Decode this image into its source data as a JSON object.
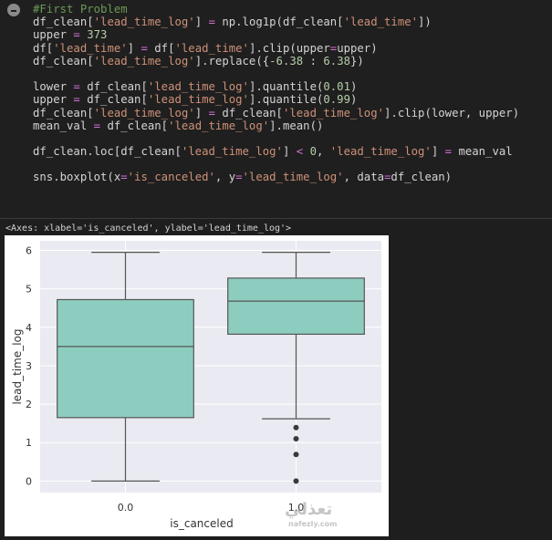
{
  "cell": {
    "lines": [
      [
        {
          "t": "#First Problem",
          "c": "cmt"
        }
      ],
      [
        {
          "t": "df_clean[",
          "c": "kw"
        },
        {
          "t": "'lead_time_log'",
          "c": "str"
        },
        {
          "t": "] ",
          "c": "kw"
        },
        {
          "t": "=",
          "c": "op"
        },
        {
          "t": " np.log1p(df_clean[",
          "c": "kw"
        },
        {
          "t": "'lead_time'",
          "c": "str"
        },
        {
          "t": "])",
          "c": "kw"
        }
      ],
      [
        {
          "t": "upper ",
          "c": "kw"
        },
        {
          "t": "=",
          "c": "op"
        },
        {
          "t": " ",
          "c": "kw"
        },
        {
          "t": "373",
          "c": "num"
        }
      ],
      [
        {
          "t": "df[",
          "c": "kw"
        },
        {
          "t": "'lead_time'",
          "c": "str"
        },
        {
          "t": "] ",
          "c": "kw"
        },
        {
          "t": "=",
          "c": "op"
        },
        {
          "t": " df[",
          "c": "kw"
        },
        {
          "t": "'lead_time'",
          "c": "str"
        },
        {
          "t": "].clip(upper",
          "c": "kw"
        },
        {
          "t": "=",
          "c": "op"
        },
        {
          "t": "upper)",
          "c": "kw"
        }
      ],
      [
        {
          "t": "df_clean[",
          "c": "kw"
        },
        {
          "t": "'lead_time_log'",
          "c": "str"
        },
        {
          "t": "].replace({",
          "c": "kw"
        },
        {
          "t": "-6.38",
          "c": "num"
        },
        {
          "t": " : ",
          "c": "kw"
        },
        {
          "t": "6.38",
          "c": "num"
        },
        {
          "t": "})",
          "c": "kw"
        }
      ],
      [
        {
          "t": "",
          "c": "kw"
        }
      ],
      [
        {
          "t": "lower ",
          "c": "kw"
        },
        {
          "t": "=",
          "c": "op"
        },
        {
          "t": " df_clean[",
          "c": "kw"
        },
        {
          "t": "'lead_time_log'",
          "c": "str"
        },
        {
          "t": "].quantile(",
          "c": "kw"
        },
        {
          "t": "0.01",
          "c": "num"
        },
        {
          "t": ")",
          "c": "kw"
        }
      ],
      [
        {
          "t": "upper ",
          "c": "kw"
        },
        {
          "t": "=",
          "c": "op"
        },
        {
          "t": " df_clean[",
          "c": "kw"
        },
        {
          "t": "'lead_time_log'",
          "c": "str"
        },
        {
          "t": "].quantile(",
          "c": "kw"
        },
        {
          "t": "0.99",
          "c": "num"
        },
        {
          "t": ")",
          "c": "kw"
        }
      ],
      [
        {
          "t": "df_clean[",
          "c": "kw"
        },
        {
          "t": "'lead_time_log'",
          "c": "str"
        },
        {
          "t": "] ",
          "c": "kw"
        },
        {
          "t": "=",
          "c": "op"
        },
        {
          "t": " df_clean[",
          "c": "kw"
        },
        {
          "t": "'lead_time_log'",
          "c": "str"
        },
        {
          "t": "].clip(lower, upper)",
          "c": "kw"
        }
      ],
      [
        {
          "t": "mean_val ",
          "c": "kw"
        },
        {
          "t": "=",
          "c": "op"
        },
        {
          "t": " df_clean[",
          "c": "kw"
        },
        {
          "t": "'lead_time_log'",
          "c": "str"
        },
        {
          "t": "].mean()",
          "c": "kw"
        }
      ],
      [
        {
          "t": "",
          "c": "kw"
        }
      ],
      [
        {
          "t": "df_clean.loc[df_clean[",
          "c": "kw"
        },
        {
          "t": "'lead_time_log'",
          "c": "str"
        },
        {
          "t": "] ",
          "c": "kw"
        },
        {
          "t": "<",
          "c": "op"
        },
        {
          "t": " ",
          "c": "kw"
        },
        {
          "t": "0",
          "c": "num"
        },
        {
          "t": ", ",
          "c": "kw"
        },
        {
          "t": "'lead_time_log'",
          "c": "str"
        },
        {
          "t": "] ",
          "c": "kw"
        },
        {
          "t": "=",
          "c": "op"
        },
        {
          "t": " mean_val",
          "c": "kw"
        }
      ],
      [
        {
          "t": "",
          "c": "kw"
        }
      ],
      [
        {
          "t": "sns.boxplot(x",
          "c": "kw"
        },
        {
          "t": "=",
          "c": "op"
        },
        {
          "t": "'is_canceled'",
          "c": "str"
        },
        {
          "t": ", y",
          "c": "kw"
        },
        {
          "t": "=",
          "c": "op"
        },
        {
          "t": "'lead_time_log'",
          "c": "str"
        },
        {
          "t": ", data",
          "c": "kw"
        },
        {
          "t": "=",
          "c": "op"
        },
        {
          "t": "df_clean)",
          "c": "kw"
        }
      ]
    ]
  },
  "output": {
    "repr": "<Axes: xlabel='is_canceled', ylabel='lead_time_log'>"
  },
  "watermark": {
    "text": "تعذلي",
    "sub": "nafezly.com"
  },
  "chart_data": {
    "type": "box",
    "xlabel": "is_canceled",
    "ylabel": "lead_time_log",
    "categories": [
      "0.0",
      "1.0"
    ],
    "ylim": [
      -0.3,
      6.25
    ],
    "yticks": [
      0,
      1,
      2,
      3,
      4,
      5,
      6
    ],
    "grid": true,
    "box_color": "#8dcdc0",
    "edge_color": "#555555",
    "background": "#eaeaf2",
    "boxes": [
      {
        "category": "0.0",
        "whislo": 0.0,
        "q1": 1.65,
        "median": 3.5,
        "q3": 4.72,
        "whishi": 5.95,
        "fliers": []
      },
      {
        "category": "1.0",
        "whislo": 1.62,
        "q1": 3.82,
        "median": 4.68,
        "q3": 5.28,
        "whishi": 5.95,
        "fliers": [
          0.0,
          0.69,
          1.1,
          1.39
        ]
      }
    ]
  }
}
